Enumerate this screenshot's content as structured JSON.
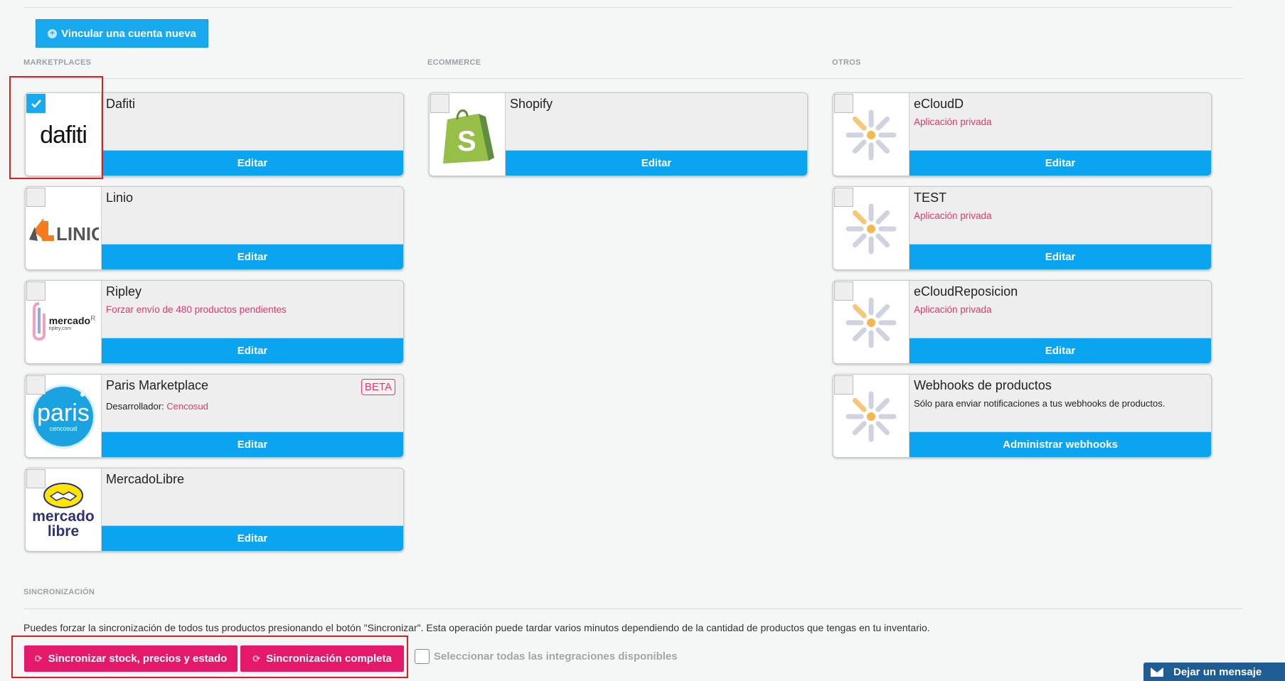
{
  "header": {
    "new_account_label": "Vincular una cuenta nueva"
  },
  "sections": {
    "marketplaces": "MARKETPLACES",
    "ecommerce": "ECOMMERCE",
    "otros": "OTROS"
  },
  "marketplaces": [
    {
      "name": "Dafiti",
      "logo_text": "dafiti",
      "subtitle": "",
      "checked": true,
      "action": "Editar"
    },
    {
      "name": "Linio",
      "logo_text": "LINIO",
      "subtitle": "",
      "checked": false,
      "action": "Editar"
    },
    {
      "name": "Ripley",
      "logo_text": "mercado",
      "logo_sup": "R",
      "logo_small": "ripley.com",
      "subtitle": "Forzar envío de 480 productos pendientes",
      "checked": false,
      "action": "Editar"
    },
    {
      "name": "Paris Marketplace",
      "logo_text": "paris",
      "logo_small": "cencosud",
      "subtitle_label": "Desarrollador:",
      "subtitle_value": "Cencosud",
      "badge": "BETA",
      "checked": false,
      "action": "Editar"
    },
    {
      "name": "MercadoLibre",
      "logo_text": "mercado",
      "logo_text2": "libre",
      "subtitle": "",
      "checked": false,
      "action": "Editar"
    }
  ],
  "ecommerce": [
    {
      "name": "Shopify",
      "logo_text": "S",
      "subtitle": "",
      "checked": false,
      "action": "Editar"
    }
  ],
  "otros": [
    {
      "name": "eCloudD",
      "subtitle": "Aplicación privada",
      "checked": false,
      "action": "Editar"
    },
    {
      "name": "TEST",
      "subtitle": "Aplicación privada",
      "checked": false,
      "action": "Editar"
    },
    {
      "name": "eCloudReposicion",
      "subtitle": "Aplicación privada",
      "checked": false,
      "action": "Editar"
    },
    {
      "name": "Webhooks de productos",
      "subtitle": "Sólo para enviar notificaciones a tus webhooks de productos.",
      "checked": false,
      "action": "Administrar webhooks"
    }
  ],
  "sync": {
    "title": "SINCRONIZACIÓN",
    "description": "Puedes forzar la sincronización de todos tus productos presionando el botón \"Sincronizar\". Esta operación puede tardar varios minutos dependiendo de la cantidad de productos que tengas en tu inventario.",
    "btn_stock": "Sincronizar stock, precios y estado",
    "btn_full": "Sincronización completa",
    "select_all": "Seleccionar todas las integraciones disponibles"
  },
  "chat": {
    "label": "Dejar un mensaje"
  },
  "colors": {
    "primary": "#0aa4f0",
    "accent": "#e5196a",
    "highlight": "#e31b23",
    "chat": "#1f5c93"
  }
}
